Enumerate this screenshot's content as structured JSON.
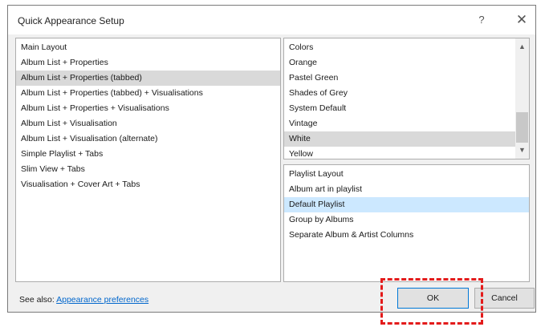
{
  "window": {
    "title": "Quick Appearance Setup",
    "help_label": "?",
    "close_label": "✕"
  },
  "main_layout": {
    "header": "Main Layout",
    "items": [
      {
        "label": "Album List + Properties",
        "selected": false
      },
      {
        "label": "Album List + Properties (tabbed)",
        "selected": true
      },
      {
        "label": "Album List + Properties (tabbed) + Visualisations",
        "selected": false
      },
      {
        "label": "Album List + Properties + Visualisations",
        "selected": false
      },
      {
        "label": "Album List + Visualisation",
        "selected": false
      },
      {
        "label": "Album List + Visualisation (alternate)",
        "selected": false
      },
      {
        "label": "Simple Playlist + Tabs",
        "selected": false
      },
      {
        "label": "Slim View + Tabs",
        "selected": false
      },
      {
        "label": "Visualisation + Cover Art + Tabs",
        "selected": false
      }
    ]
  },
  "colors": {
    "header": "Colors",
    "items": [
      {
        "label": "Orange",
        "selected": false
      },
      {
        "label": "Pastel Green",
        "selected": false
      },
      {
        "label": "Shades of Grey",
        "selected": false
      },
      {
        "label": "System Default",
        "selected": false
      },
      {
        "label": "Vintage",
        "selected": false
      },
      {
        "label": "White",
        "selected": true
      },
      {
        "label": "Yellow",
        "selected": false
      }
    ],
    "scroll_up_icon": "▲",
    "scroll_down_icon": "▼"
  },
  "playlist_layout": {
    "header": "Playlist Layout",
    "items": [
      {
        "label": "Album art in playlist",
        "selected": false
      },
      {
        "label": "Default Playlist",
        "selected": true
      },
      {
        "label": "Group by Albums",
        "selected": false
      },
      {
        "label": "Separate Album & Artist Columns",
        "selected": false
      }
    ]
  },
  "footer": {
    "see_also_label": "See also:",
    "link_label": "Appearance preferences",
    "ok_label": "OK",
    "cancel_label": "Cancel"
  },
  "colors_meta": {
    "highlight_color": "#e31b1b",
    "selection_gray": "#d9d9d9",
    "selection_blue": "#cce8ff",
    "link_color": "#0066cc"
  }
}
